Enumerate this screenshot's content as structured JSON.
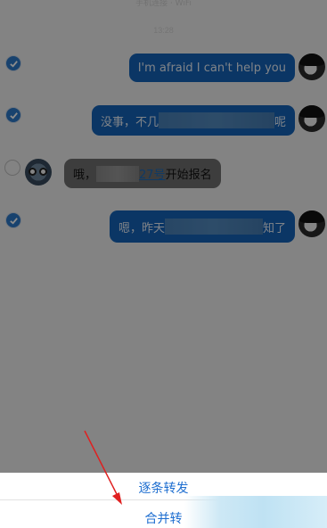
{
  "status_bar": {
    "text": "手机连接 · WiFi"
  },
  "timestamp": "13:28",
  "messages": [
    {
      "direction": "out",
      "selected": true,
      "text": "I'm afraid I can't help you"
    },
    {
      "direction": "out",
      "selected": true,
      "prefix": "没事，不几",
      "suffix": "呢"
    },
    {
      "direction": "in",
      "selected": false,
      "prefix": "哦，",
      "link": "27号",
      "suffix": "开始报名"
    },
    {
      "direction": "out",
      "selected": true,
      "prefix": "嗯，昨天",
      "suffix": "知了"
    }
  ],
  "sheet": {
    "option_one": "逐条转发",
    "option_two": "合并转"
  },
  "colors": {
    "bubble_out": "#1463b9",
    "check": "#2c78c8",
    "sheet_text": "#1e6ed0",
    "arrow": "#e02020"
  }
}
